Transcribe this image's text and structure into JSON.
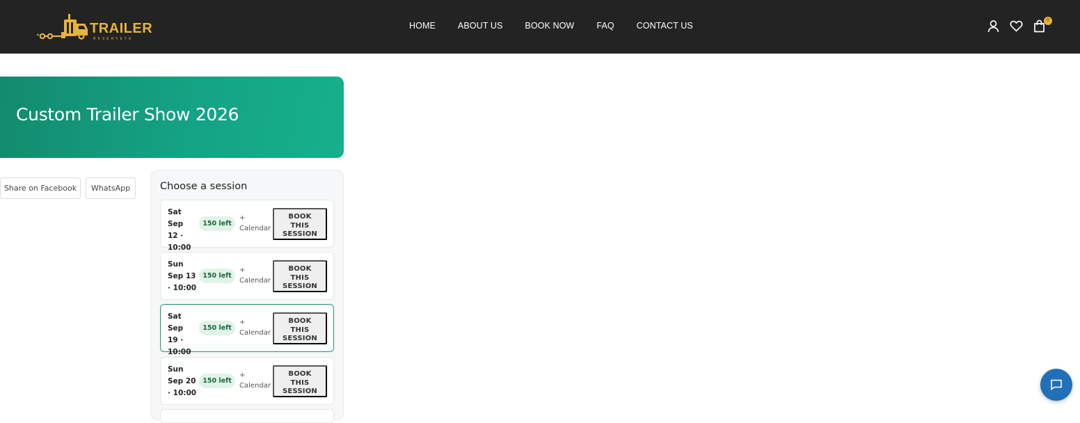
{
  "header": {
    "logo_text": "TRAILER",
    "logo_sub": "RESERVEYE",
    "nav": [
      "HOME",
      "ABOUT US",
      "BOOK NOW",
      "FAQ",
      "CONTACT US"
    ],
    "icons": [
      "user-icon",
      "heart-icon",
      "cart-icon"
    ],
    "cart_count": "0",
    "colors": {
      "bar": "#232323",
      "brand": "#e8b33a"
    }
  },
  "hero": {
    "title": "Custom Trailer Show 2026",
    "colors": {
      "from": "#138a6e",
      "to": "#16b08c"
    }
  },
  "share": {
    "facebook_label": "Share on Facebook",
    "whatsapp_label": "WhatsApp"
  },
  "sessions": {
    "title": "Choose a session",
    "selected_index": 2,
    "items": [
      {
        "date_line1": "Sat Sep",
        "date_line2": "12 ·",
        "date_line3": "10:00",
        "availability": "150 left",
        "calendar_plus": "+",
        "calendar_label": "Calendar",
        "book_line1": "BOOK",
        "book_line2": "THIS",
        "book_line3": "SESSION"
      },
      {
        "date_line1": "Sun",
        "date_line2": "Sep 13",
        "date_line3": "· 10:00",
        "availability": "150 left",
        "calendar_plus": "+",
        "calendar_label": "Calendar",
        "book_line1": "BOOK",
        "book_line2": "THIS",
        "book_line3": "SESSION"
      },
      {
        "date_line1": "Sat Sep",
        "date_line2": "19 ·",
        "date_line3": "10:00",
        "availability": "150 left",
        "calendar_plus": "+",
        "calendar_label": "Calendar",
        "book_line1": "BOOK",
        "book_line2": "THIS",
        "book_line3": "SESSION"
      },
      {
        "date_line1": "Sun",
        "date_line2": "Sep 20",
        "date_line3": "· 10:00",
        "availability": "150 left",
        "calendar_plus": "+",
        "calendar_label": "Calendar",
        "book_line1": "BOOK",
        "book_line2": "THIS",
        "book_line3": "SESSION"
      }
    ],
    "colors": {
      "badge_bg": "#e2f3e8",
      "badge_text": "#17693c",
      "selected_border": "#16997a"
    }
  },
  "chat": {
    "icon": "chat-icon",
    "color": "#2270b8"
  }
}
